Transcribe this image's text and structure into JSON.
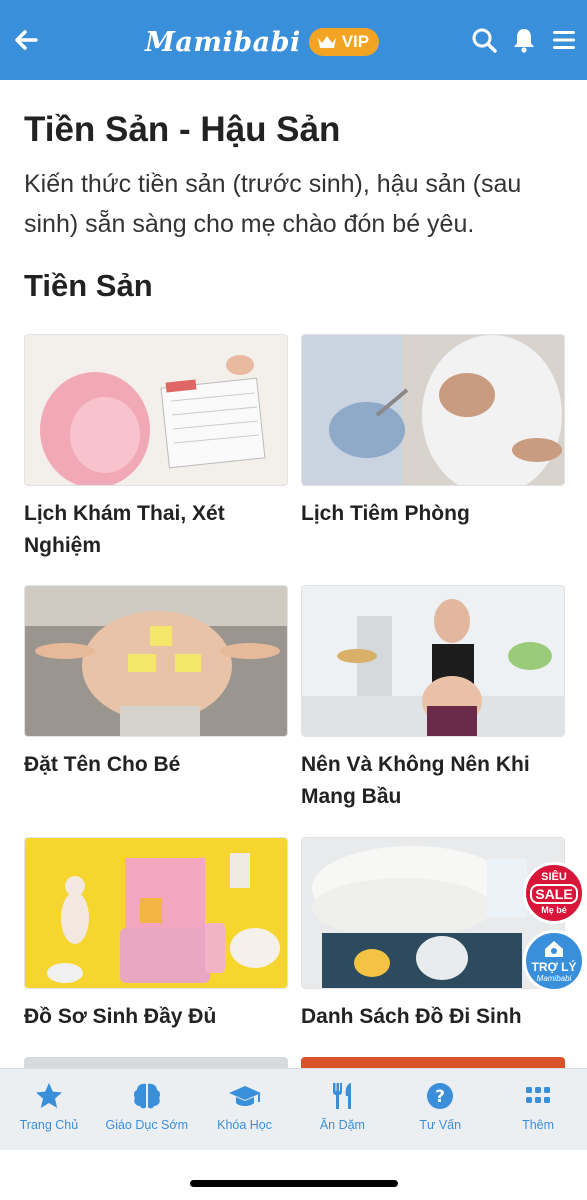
{
  "header": {
    "brand": "Mamibabi",
    "vip_label": "VIP",
    "icons": [
      "back-arrow-icon",
      "search-icon",
      "bell-icon",
      "menu-icon"
    ],
    "bg_color": "#3a8fdb",
    "vip_color": "#f4a423"
  },
  "main": {
    "title": "Tiền Sản - Hậu Sản",
    "description": "Kiến thức tiền sản (trước sinh), hậu sản (sau sinh) sẵn sàng cho mẹ chào đón bé yêu.",
    "section_title": "Tiền Sản",
    "cards": [
      {
        "label": "Lịch Khám Thai, Xét Nghiệm"
      },
      {
        "label": "Lịch Tiêm Phòng"
      },
      {
        "label": "Đặt Tên Cho Bé"
      },
      {
        "label": "Nên Và Không Nên Khi Mang Bầu"
      },
      {
        "label": "Đồ Sơ Sinh Đầy Đủ"
      },
      {
        "label": "Danh Sách Đồ Đi Sinh"
      }
    ]
  },
  "floating": {
    "sale": {
      "line1": "SIÊU",
      "line2": "SALE",
      "line3": "Mẹ bé"
    },
    "assistant": {
      "line1": "TRỢ LÝ",
      "line2": "Mamibabi"
    }
  },
  "bottom_nav": {
    "items": [
      {
        "label": "Trang Chủ",
        "icon": "star-icon"
      },
      {
        "label": "Giáo Dục Sớm",
        "icon": "brain-icon"
      },
      {
        "label": "Khóa Học",
        "icon": "graduation-cap-icon"
      },
      {
        "label": "Ăn Dặm",
        "icon": "fork-knife-icon"
      },
      {
        "label": "Tư Vấn",
        "icon": "question-icon"
      },
      {
        "label": "Thêm",
        "icon": "grid-icon"
      }
    ]
  }
}
